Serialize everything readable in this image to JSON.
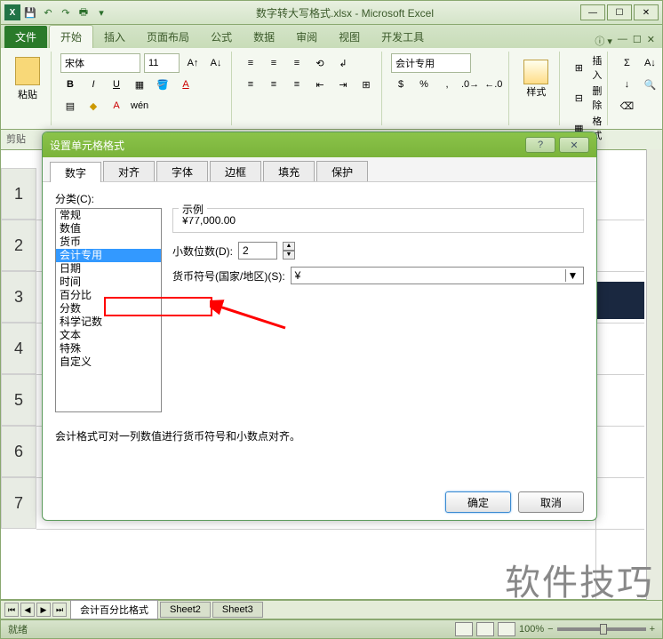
{
  "titlebar": {
    "filename": "数字转大写格式.xlsx - Microsoft Excel"
  },
  "ribbon": {
    "tabs": {
      "file": "文件",
      "home": "开始",
      "insert": "插入",
      "layout": "页面布局",
      "formulas": "公式",
      "data": "数据",
      "review": "审阅",
      "view": "视图",
      "developer": "开发工具"
    },
    "clipboard": {
      "paste": "粘贴",
      "cut_label": "剪贴"
    },
    "font": {
      "name": "宋体",
      "size": "11"
    },
    "number_format": "会计专用",
    "styles": "样式",
    "cells": {
      "insert": "插入",
      "delete": "删除",
      "format": "格式"
    }
  },
  "dialog": {
    "title": "设置单元格格式",
    "help_icon": "?",
    "close_icon": "✕",
    "tabs": [
      "数字",
      "对齐",
      "字体",
      "边框",
      "填充",
      "保护"
    ],
    "category_label": "分类(C):",
    "categories": [
      "常规",
      "数值",
      "货币",
      "会计专用",
      "日期",
      "时间",
      "百分比",
      "分数",
      "科学记数",
      "文本",
      "特殊",
      "自定义"
    ],
    "selected_category_index": 3,
    "sample": {
      "label": "示例",
      "value": "¥77,000.00"
    },
    "decimal_places": {
      "label": "小数位数(D):",
      "value": "2"
    },
    "currency_symbol": {
      "label": "货币符号(国家/地区)(S):",
      "value": "¥"
    },
    "description": "会计格式可对一列数值进行货币符号和小数点对齐。",
    "ok": "确定",
    "cancel": "取消"
  },
  "sheet_tabs": {
    "active": "会计百分比格式",
    "others": [
      "Sheet2",
      "Sheet3"
    ]
  },
  "statusbar": {
    "ready": "就绪",
    "zoom": "100%"
  },
  "rows": [
    "1",
    "2",
    "3",
    "4",
    "5",
    "6",
    "7"
  ],
  "watermark": "软件技巧"
}
